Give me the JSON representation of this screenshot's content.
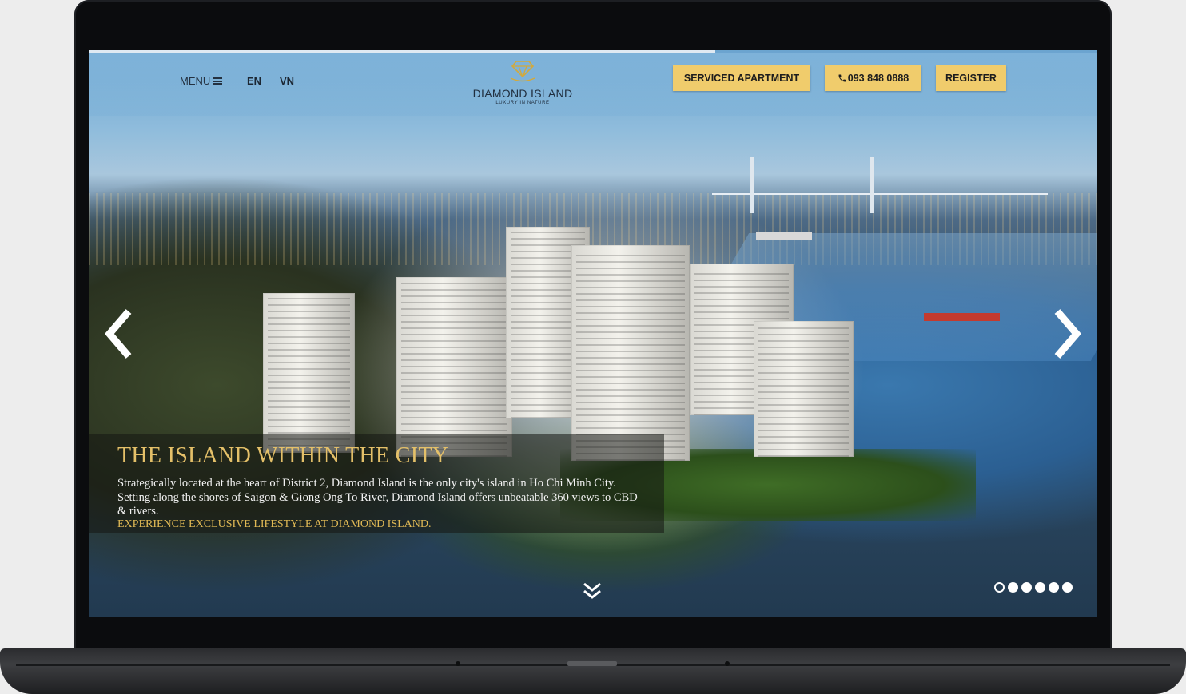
{
  "header": {
    "menu_label": "MENU",
    "lang_en": "EN",
    "lang_vn": "VN",
    "logo_name": "DIAMOND ISLAND",
    "logo_tagline": "LUXURY IN NATURE",
    "serviced_apartment_label": "SERVICED APARTMENT",
    "phone_label": "093 848 0888",
    "register_label": "REGISTER"
  },
  "slide": {
    "title": "THE ISLAND WITHIN THE CITY",
    "description": "Strategically located at the heart of District 2, Diamond Island is the only city's island in Ho Chi Minh City. Setting along the shores of Saigon & Giong Ong To River, Diamond Island offers unbeatable 360 views to CBD & rivers.",
    "cta": "EXPERIENCE EXCLUSIVE LIFESTYLE AT DIAMOND ISLAND."
  },
  "slider": {
    "total_slides": 6,
    "active_index": 0
  },
  "colors": {
    "gold_button": "#f0cc6c",
    "caption_title": "#e4c069",
    "caption_cta": "#e0b955",
    "header_text": "#1f2d3d"
  },
  "icons": {
    "menu": "hamburger-icon",
    "phone": "phone-icon",
    "prev": "chevron-left-icon",
    "next": "chevron-right-icon",
    "scroll": "double-chevron-down-icon",
    "logo": "diamond-icon"
  }
}
